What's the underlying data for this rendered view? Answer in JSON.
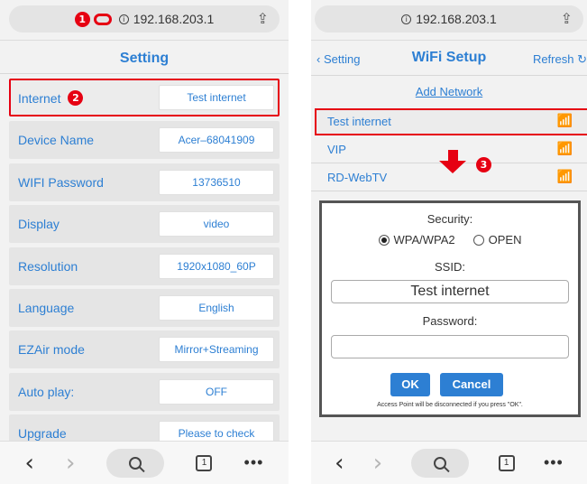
{
  "left": {
    "url": "192.168.203.1",
    "badge1": "1",
    "title": "Setting",
    "rows": [
      {
        "label": "Internet",
        "value": "Test internet"
      },
      {
        "label": "Device Name",
        "value": "Acer–68041909"
      },
      {
        "label": "WIFI Password",
        "value": "13736510"
      },
      {
        "label": "Display",
        "value": "video"
      },
      {
        "label": "Resolution",
        "value": "1920x1080_60P"
      },
      {
        "label": "Language",
        "value": "English"
      },
      {
        "label": "EZAir mode",
        "value": "Mirror+Streaming"
      },
      {
        "label": "Auto play:",
        "value": "OFF"
      },
      {
        "label": "Upgrade",
        "value": "Please to check"
      }
    ],
    "badge2": "2",
    "tabs_count": "1"
  },
  "right": {
    "url": "192.168.203.1",
    "back_label": "Setting",
    "title": "WiFi Setup",
    "refresh_label": "Refresh",
    "add_network": "Add Network",
    "networks": [
      "Test internet",
      "VIP",
      "RD-WebTV"
    ],
    "badge3": "3",
    "security_label": "Security:",
    "security_options": [
      "WPA/WPA2",
      "OPEN"
    ],
    "security_selected": "WPA/WPA2",
    "ssid_label": "SSID:",
    "ssid_value": "Test internet",
    "password_label": "Password:",
    "password_value": "",
    "ok_label": "OK",
    "cancel_label": "Cancel",
    "note": "Access Point will be disconnected if you press \"OK\".",
    "tabs_count": "1"
  },
  "colors": {
    "accent": "#2d7fd3",
    "highlight": "#e60012"
  },
  "icons": [
    "info-icon",
    "share-icon",
    "wifi-icon",
    "refresh-icon",
    "search-icon",
    "tabs-icon",
    "more-icon"
  ]
}
